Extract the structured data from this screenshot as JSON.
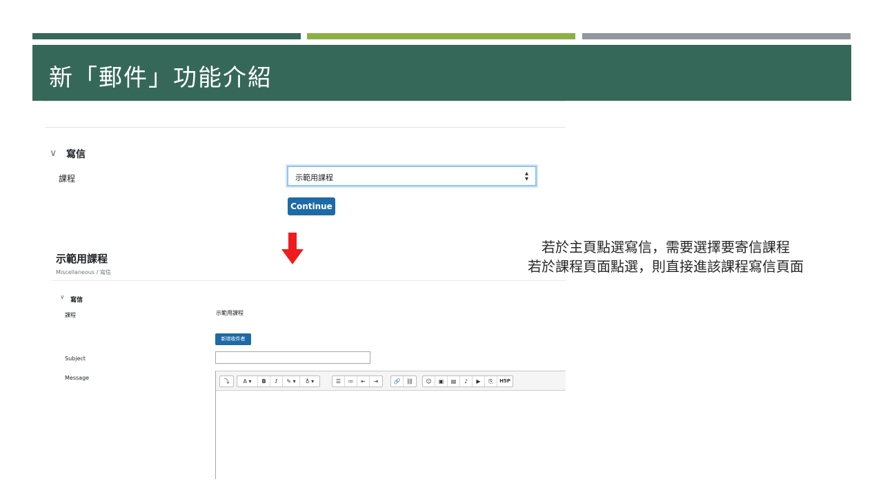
{
  "colors": {
    "stripe_dark": "#36685a",
    "stripe_green": "#8cb043",
    "stripe_gray": "#9097a0",
    "banner": "#36685a",
    "arrow": "#ee1c1c",
    "button": "#1d6aa8"
  },
  "slide": {
    "title": "新「郵件」功能介紹"
  },
  "compose_page": {
    "section_title": "寫信",
    "course_label": "課程",
    "course_select_value": "示範用課程",
    "continue_label": "Continue"
  },
  "course_page": {
    "heading": "示範用課程",
    "breadcrumb": "Miscellaneous / 寫信",
    "section_title": "寫信",
    "course_label": "課程",
    "course_value": "示範用課程",
    "add_recipients_label": "新增收件者",
    "subject_label": "Subject",
    "message_label": "Message"
  },
  "editor_toolbar": {
    "groups": [
      [
        "⤵"
      ],
      [
        "A ▾",
        "B",
        "I",
        "✎ ▾",
        "♁ ▾"
      ],
      [
        "☰",
        "≔",
        "⇤",
        "⇥"
      ],
      [
        "🔗",
        "⛓"
      ],
      [
        "☺",
        "▣",
        "▤",
        "♪",
        "▶",
        "⎘",
        "H5P"
      ]
    ],
    "icons": [
      "collapse-icon",
      "font-color-icon",
      "bold-icon",
      "italic-icon",
      "highlight-icon",
      "lightbulb-icon",
      "unordered-list-icon",
      "ordered-list-icon",
      "outdent-icon",
      "indent-icon",
      "link-icon",
      "unlink-icon",
      "emoji-icon",
      "image-icon",
      "media-icon",
      "audio-icon",
      "video-icon",
      "manage-files-icon",
      "h5p-icon"
    ]
  },
  "note": {
    "line1": "若於主頁點選寫信，需要選擇要寄信課程",
    "line2": "若於課程頁面點選，則直接進該課程寫信頁面"
  }
}
